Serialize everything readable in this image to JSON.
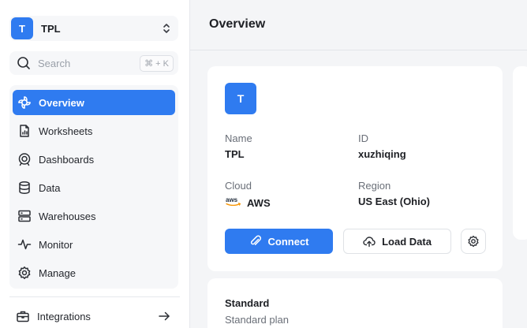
{
  "workspace": {
    "avatar_letter": "T",
    "name": "TPL"
  },
  "search": {
    "placeholder": "Search",
    "shortcut": "⌘ + K"
  },
  "nav": {
    "items": [
      {
        "label": "Overview",
        "icon": "overview-icon",
        "active": true
      },
      {
        "label": "Worksheets",
        "icon": "worksheets-icon",
        "active": false
      },
      {
        "label": "Dashboards",
        "icon": "dashboards-icon",
        "active": false
      },
      {
        "label": "Data",
        "icon": "database-icon",
        "active": false
      },
      {
        "label": "Warehouses",
        "icon": "warehouses-icon",
        "active": false
      },
      {
        "label": "Monitor",
        "icon": "pulse-icon",
        "active": false
      },
      {
        "label": "Manage",
        "icon": "gear-icon",
        "active": false
      }
    ],
    "integrations": {
      "label": "Integrations",
      "icon": "toolbox-icon"
    }
  },
  "header": {
    "title": "Overview"
  },
  "project": {
    "avatar_letter": "T",
    "name_label": "Name",
    "name_value": "TPL",
    "id_label": "ID",
    "id_value": "xuzhiqing",
    "cloud_label": "Cloud",
    "cloud_value": "AWS",
    "cloud_logo_text": "aws",
    "region_label": "Region",
    "region_value": "US East (Ohio)"
  },
  "actions": {
    "connect_label": "Connect",
    "load_label": "Load Data"
  },
  "plan": {
    "title": "Standard",
    "subtitle": "Standard plan"
  },
  "colors": {
    "accent": "#2f7bf0",
    "sidebar_bg": "#ffffff",
    "page_bg": "#f4f5f7"
  }
}
